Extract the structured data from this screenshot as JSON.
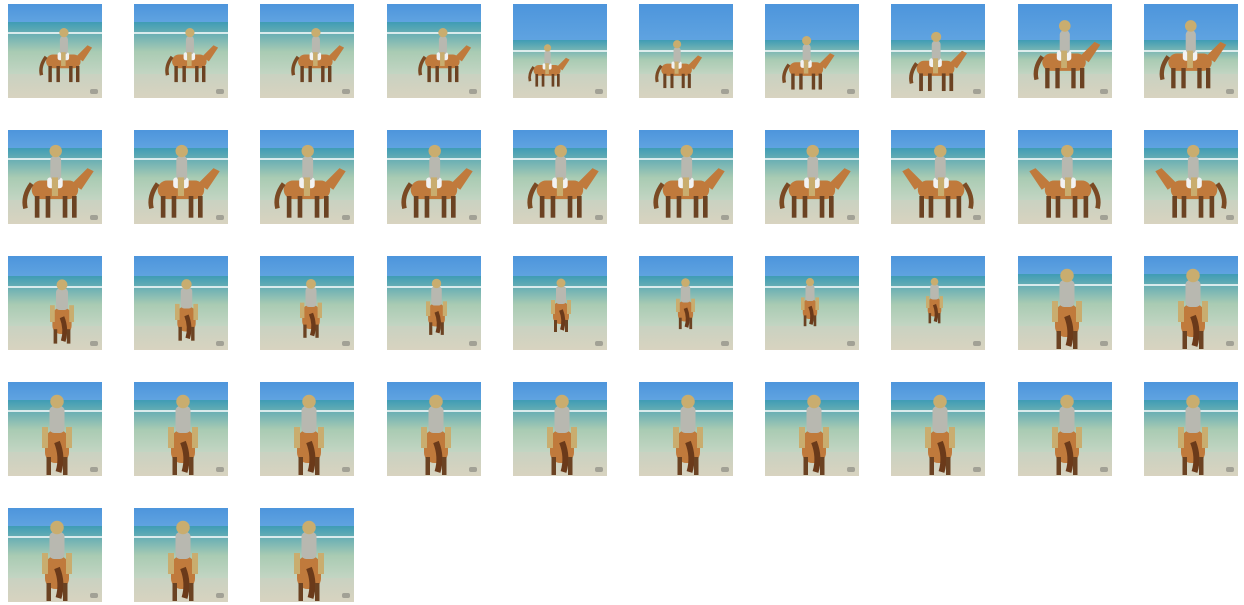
{
  "gallery": {
    "columns": 10,
    "photo_count": 43,
    "icon": "horse-rider-photo-icon",
    "colors": {
      "page_background": "#ffffff",
      "sky": "#5fa3e0",
      "sea": "#a9cbb3",
      "sand": "#d8d3c0",
      "horse": "#c07a3c",
      "rider": "#c9ad6f",
      "foam": "#ffffff"
    }
  }
}
